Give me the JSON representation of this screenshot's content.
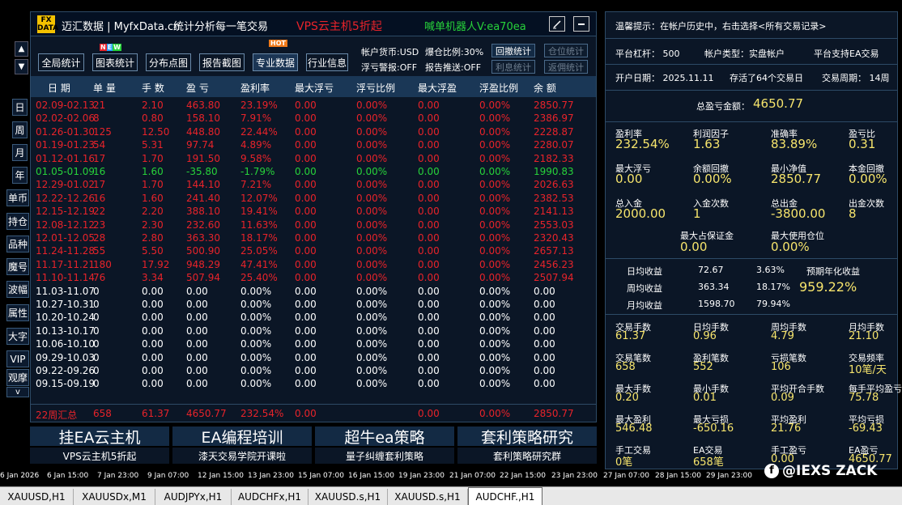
{
  "header": {
    "logo": "FX DATA",
    "title": "迈汇数据 | MyfxData.cn",
    "subtitle": "统计分析每一笔交易",
    "promo": "VPS云主机5折起",
    "robot": "喊单机器人V:ea70ea"
  },
  "toolbar": {
    "buttons": [
      "全局统计",
      "图表统计",
      "分布点图",
      "报告截图",
      "专业数据",
      "行业信息"
    ],
    "new_badge": "NEW",
    "hot_badge": "HOT",
    "account_currency": "帐户货币:USD",
    "margin_ratio": "爆仓比例:30%",
    "float_loss_alert": "浮亏警报:OFF",
    "report_push": "报告推送:OFF",
    "small_buttons": [
      "回撤统计",
      "仓位统计",
      "利息统计",
      "返佣统计"
    ]
  },
  "left_nav": {
    "up": "▲",
    "down": "▼",
    "items": [
      "日",
      "周",
      "月",
      "年",
      "单币",
      "持仓",
      "品种",
      "魔号",
      "波幅",
      "属性",
      "大字",
      "VIP",
      "观摩"
    ],
    "more": "v"
  },
  "table": {
    "headers": [
      "日 期",
      "单 量",
      "手 数",
      "盈 亏",
      "盈利率",
      "最大浮亏",
      "浮亏比例",
      "最大浮盈",
      "浮盈比例",
      "余 额"
    ],
    "rows": [
      [
        "02.09-02.13",
        "21",
        "2.10",
        "463.80",
        "23.19%",
        "0.00",
        "0.00%",
        "0.00",
        "0.00%",
        "2850.77"
      ],
      [
        "02.02-02.06",
        "8",
        "0.80",
        "158.10",
        "7.91%",
        "0.00",
        "0.00%",
        "0.00",
        "0.00%",
        "2386.97"
      ],
      [
        "01.26-01.30",
        "125",
        "12.50",
        "448.80",
        "22.44%",
        "0.00",
        "0.00%",
        "0.00",
        "0.00%",
        "2228.87"
      ],
      [
        "01.19-01.23",
        "54",
        "5.31",
        "97.74",
        "4.89%",
        "0.00",
        "0.00%",
        "0.00",
        "0.00%",
        "2280.07"
      ],
      [
        "01.12-01.16",
        "17",
        "1.70",
        "191.50",
        "9.58%",
        "0.00",
        "0.00%",
        "0.00",
        "0.00%",
        "2182.33"
      ],
      [
        "01.05-01.09",
        "16",
        "1.60",
        "-35.80",
        "-1.79%",
        "0.00",
        "0.00%",
        "0.00",
        "0.00%",
        "1990.83"
      ],
      [
        "12.29-01.02",
        "17",
        "1.70",
        "144.10",
        "7.21%",
        "0.00",
        "0.00%",
        "0.00",
        "0.00%",
        "2026.63"
      ],
      [
        "12.22-12.26",
        "16",
        "1.60",
        "241.40",
        "12.07%",
        "0.00",
        "0.00%",
        "0.00",
        "0.00%",
        "2382.53"
      ],
      [
        "12.15-12.19",
        "22",
        "2.20",
        "388.10",
        "19.41%",
        "0.00",
        "0.00%",
        "0.00",
        "0.00%",
        "2141.13"
      ],
      [
        "12.08-12.12",
        "23",
        "2.30",
        "232.60",
        "11.63%",
        "0.00",
        "0.00%",
        "0.00",
        "0.00%",
        "2553.03"
      ],
      [
        "12.01-12.05",
        "28",
        "2.80",
        "363.30",
        "18.17%",
        "0.00",
        "0.00%",
        "0.00",
        "0.00%",
        "2320.43"
      ],
      [
        "11.24-11.28",
        "55",
        "5.50",
        "500.90",
        "25.05%",
        "0.00",
        "0.00%",
        "0.00",
        "0.00%",
        "2657.13"
      ],
      [
        "11.17-11.21",
        "180",
        "17.92",
        "948.29",
        "47.41%",
        "0.00",
        "0.00%",
        "0.00",
        "0.00%",
        "2456.23"
      ],
      [
        "11.10-11.14",
        "76",
        "3.34",
        "507.94",
        "25.40%",
        "0.00",
        "0.00%",
        "0.00",
        "0.00%",
        "2507.94"
      ],
      [
        "11.03-11.07",
        "0",
        "0.00",
        "0.00",
        "0.00%",
        "0.00",
        "0.00%",
        "0.00",
        "0.00%",
        "0.00"
      ],
      [
        "10.27-10.31",
        "0",
        "0.00",
        "0.00",
        "0.00%",
        "0.00",
        "0.00%",
        "0.00",
        "0.00%",
        "0.00"
      ],
      [
        "10.20-10.24",
        "0",
        "0.00",
        "0.00",
        "0.00%",
        "0.00",
        "0.00%",
        "0.00",
        "0.00%",
        "0.00"
      ],
      [
        "10.13-10.17",
        "0",
        "0.00",
        "0.00",
        "0.00%",
        "0.00",
        "0.00%",
        "0.00",
        "0.00%",
        "0.00"
      ],
      [
        "10.06-10.10",
        "0",
        "0.00",
        "0.00",
        "0.00%",
        "0.00",
        "0.00%",
        "0.00",
        "0.00%",
        "0.00"
      ],
      [
        "09.29-10.03",
        "0",
        "0.00",
        "0.00",
        "0.00%",
        "0.00",
        "0.00%",
        "0.00",
        "0.00%",
        "0.00"
      ],
      [
        "09.22-09.26",
        "0",
        "0.00",
        "0.00",
        "0.00%",
        "0.00",
        "0.00%",
        "0.00",
        "0.00%",
        "0.00"
      ],
      [
        "09.15-09.19",
        "0",
        "0.00",
        "0.00",
        "0.00%",
        "0.00",
        "0.00%",
        "0.00",
        "0.00%",
        "0.00"
      ]
    ],
    "row_status": [
      "profit",
      "profit",
      "profit",
      "profit",
      "profit",
      "loss",
      "profit",
      "profit",
      "profit",
      "profit",
      "profit",
      "profit",
      "profit",
      "profit",
      "zero",
      "zero",
      "zero",
      "zero",
      "zero",
      "zero",
      "zero",
      "zero"
    ],
    "footer": [
      "22周汇总",
      "658",
      "61.37",
      "4650.77",
      "232.54%",
      "0.00",
      "",
      "0.00",
      "0.00%",
      "2850.77"
    ]
  },
  "banners": [
    {
      "title": "挂EA云主机",
      "sub": "VPS云主机5折起"
    },
    {
      "title": "EA编程培训",
      "sub": "漆天交易学院开课啦"
    },
    {
      "title": "超牛ea策略",
      "sub": "量子纠缠套利策略"
    },
    {
      "title": "套利策略研究",
      "sub": "套利策略研究群"
    }
  ],
  "stats": {
    "tip": "温馨提示：在帐户历史中，右击选择<所有交易记录>",
    "platform_leverage": "平台杠杆：  500",
    "account_type": "帐户类型：实盘帐户",
    "ea_support": "平台支持EA交易",
    "open_date": "开户日期：  2025.11.11",
    "trade_days": "存活了64个交易日",
    "trade_period": "交易周期：  14周",
    "total_profit_label": "总盈亏金额：",
    "total_profit_value": "4650.77",
    "grid1": [
      {
        "label": "盈利率",
        "value": "232.54%"
      },
      {
        "label": "利润因子",
        "value": "1.63"
      },
      {
        "label": "准确率",
        "value": "83.89%"
      },
      {
        "label": "盈亏比",
        "value": "0.31"
      },
      {
        "label": "最大浮亏",
        "value": "0.00"
      },
      {
        "label": "余额回撤",
        "value": "0.00%"
      },
      {
        "label": "最小净值",
        "value": "2850.77"
      },
      {
        "label": "本金回撤",
        "value": "0.00%"
      },
      {
        "label": "总入金",
        "value": "2000.00"
      },
      {
        "label": "入金次数",
        "value": "1"
      },
      {
        "label": "总出金",
        "value": "-3800.00"
      },
      {
        "label": "出金次数",
        "value": "8"
      }
    ],
    "margin_label": "最大占保证金",
    "margin_value": "0.00",
    "position_label": "最大使用仓位",
    "position_value": "0.00%",
    "avg": [
      {
        "label": "日均收益",
        "amount": "72.67",
        "pct": "3.63%"
      },
      {
        "label": "周均收益",
        "amount": "363.34",
        "pct": "18.17%"
      },
      {
        "label": "月均收益",
        "amount": "1598.70",
        "pct": "79.94%"
      }
    ],
    "annual_label": "预期年化收益",
    "annual_value": "959.22%",
    "grid2": [
      {
        "label": "交易手数",
        "value": "61.37"
      },
      {
        "label": "日均手数",
        "value": "0.96"
      },
      {
        "label": "周均手数",
        "value": "4.79"
      },
      {
        "label": "月均手数",
        "value": "21.10"
      },
      {
        "label": "交易笔数",
        "value": "658"
      },
      {
        "label": "盈利笔数",
        "value": "552"
      },
      {
        "label": "亏损笔数",
        "value": "106"
      },
      {
        "label": "交易频率",
        "value": "10笔/天"
      },
      {
        "label": "最大手数",
        "value": "0.20"
      },
      {
        "label": "最小手数",
        "value": "0.01"
      },
      {
        "label": "平均开合手数",
        "value": "0.09"
      },
      {
        "label": "每手平均盈亏",
        "value": "75.78"
      },
      {
        "label": "最大盈利",
        "value": "546.48"
      },
      {
        "label": "最大亏损",
        "value": "-650.16"
      },
      {
        "label": "平均盈利",
        "value": "21.76"
      },
      {
        "label": "平均亏损",
        "value": "-69.43"
      },
      {
        "label": "手工交易",
        "value": "0笔"
      },
      {
        "label": "EA交易",
        "value": "658笔"
      },
      {
        "label": "手工盈亏",
        "value": "0.00"
      },
      {
        "label": "EA盈亏",
        "value": "4650.77"
      }
    ]
  },
  "axis_ticks": [
    "6 Jan 2026",
    "6 Jan 15:00",
    "7 Jan 23:00",
    "9 Jan 07:00",
    "12 Jan 15:00",
    "13 Jan 23:00",
    "15 Jan 07:00",
    "16 Jan 15:00",
    "19 Jan 23:00",
    "21 Jan 07:00",
    "22 Jan 15:00",
    "23 Jan 23:00",
    "27 Jan 07:00",
    "28 Jan 15:00",
    "29 Jan 23:00"
  ],
  "watermark": "@IEXS ZACK",
  "tabs": [
    "XAUUSD,H1",
    "XAUUSDx,M1",
    "AUDJPYx,H1",
    "AUDCHFx,H1",
    "XAUUSD.s,H1",
    "XAUUSD.s,H1",
    "AUDCHF.,H1"
  ],
  "active_tab": 6,
  "colors": {
    "profit": "#e8232a",
    "loss": "#27d33a",
    "zero": "#ffffff",
    "value": "#f6e46c",
    "accent_red": "#e8232a",
    "accent_green": "#27d33a"
  }
}
